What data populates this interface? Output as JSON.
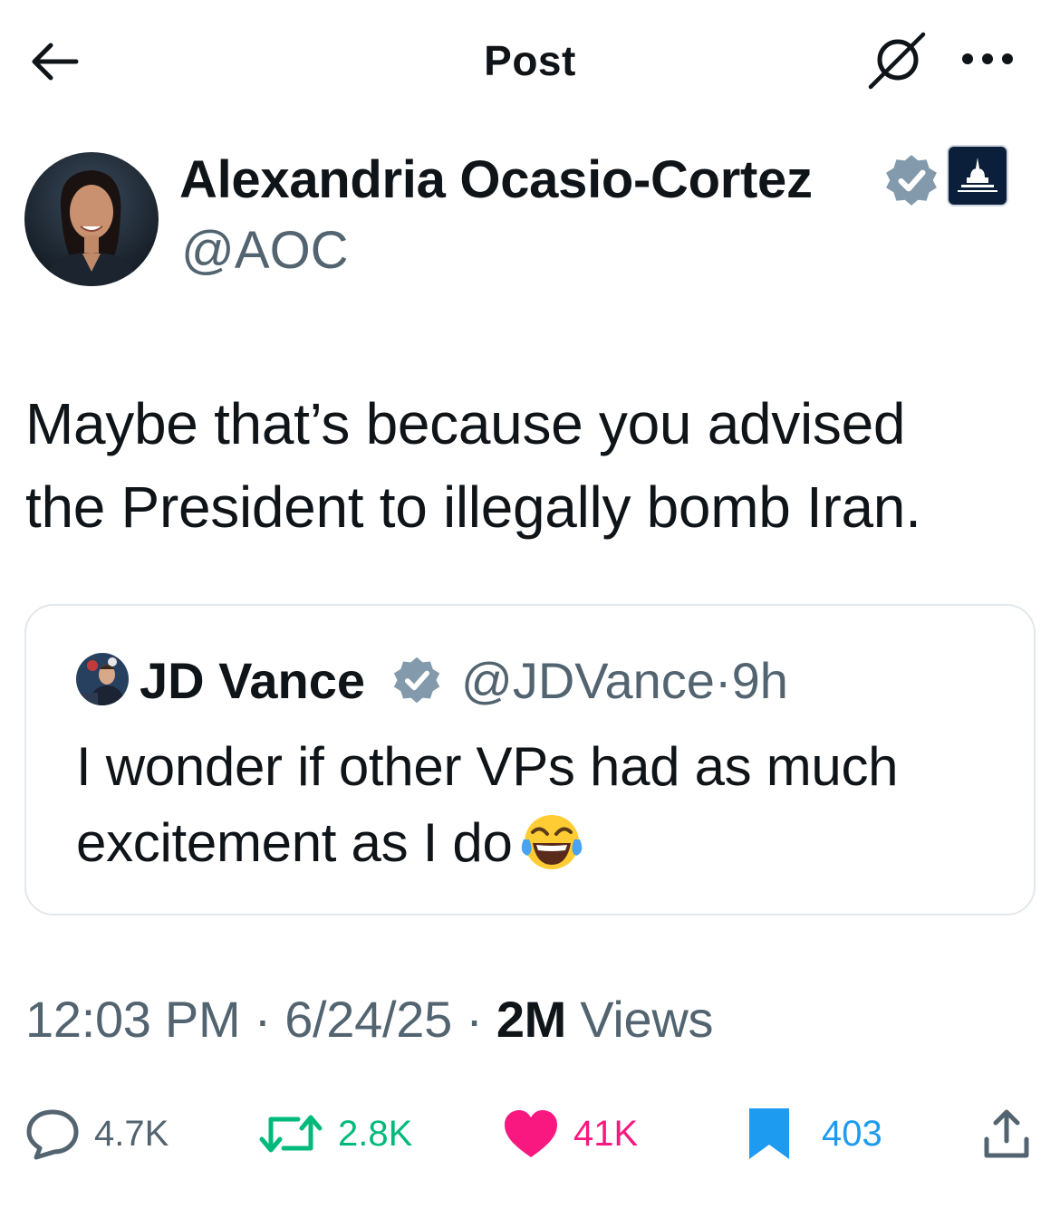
{
  "header": {
    "title": "Post"
  },
  "author": {
    "name": "Alexandria Ocasio-Cortez",
    "handle": "@AOC"
  },
  "tweet": {
    "text_line1": "Maybe that’s because you advised",
    "text_line2": "the President to illegally bomb Iran."
  },
  "quote": {
    "name": "JD Vance",
    "handle": "@JDVance",
    "separator": "·",
    "time": "9h",
    "text_line1": "I wonder if other VPs had as much",
    "text_line2": "excitement as I do"
  },
  "meta": {
    "time": "12:03 PM",
    "separator": "·",
    "date": "6/24/25",
    "views_count": "2M",
    "views_label": "Views"
  },
  "actions": {
    "replies": "4.7K",
    "reposts": "2.8K",
    "likes": "41K",
    "bookmarks": "403"
  },
  "colors": {
    "text": "#0f1419",
    "secondary": "#536471",
    "verified": "#829aab",
    "repost": "#00ba7c",
    "like": "#f91880",
    "bookmark": "#1d9bf0",
    "border": "#e1e8ed"
  },
  "icons": [
    "back-arrow-icon",
    "grok-icon",
    "more-icon",
    "verified-badge-icon",
    "house-democrats-icon",
    "reply-icon",
    "repost-icon",
    "like-icon",
    "bookmark-icon",
    "share-icon",
    "laughing-tears-emoji"
  ]
}
